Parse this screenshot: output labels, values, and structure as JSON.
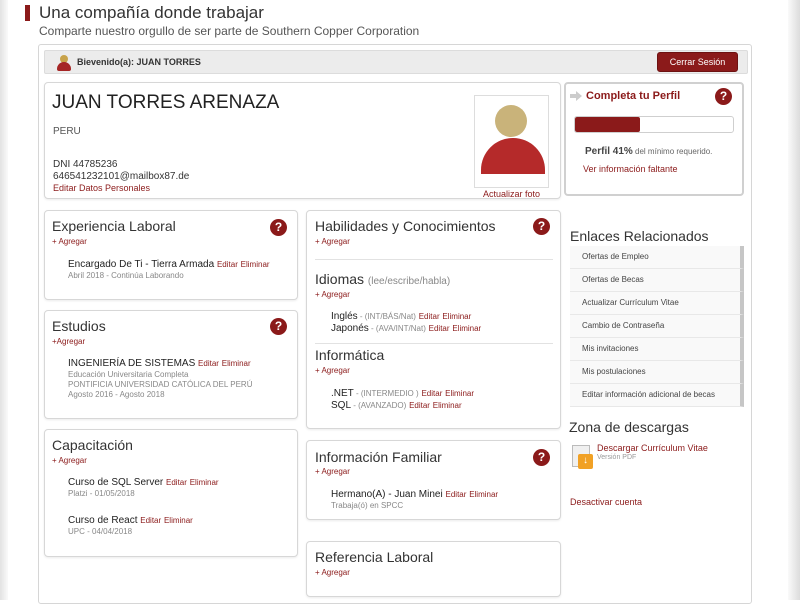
{
  "header": {
    "title": "Una compañía donde trabajar",
    "subtitle": "Comparte nuestro orgullo de ser parte de Southern Copper Corporation"
  },
  "welcome": {
    "text": "Bievenido(a): JUAN TORRES",
    "logout_label": "Cerrar Sesión"
  },
  "profile": {
    "name": "JUAN TORRES ARENAZA",
    "country": "PERU",
    "dni": "DNI 44785236",
    "contact": "646541232101@mailbox87.de",
    "edit_label": "Editar Datos Personales",
    "photo_link": "Actualizar foto"
  },
  "experiencia": {
    "title": "Experiencia Laboral",
    "add": "+ Agregar",
    "items": [
      {
        "main": "Encargado De Ti - Tierra Armada",
        "edit": "Editar",
        "delete": "Eliminar",
        "sub": "Abril 2018 - Continúa Laborando"
      }
    ]
  },
  "estudios": {
    "title": "Estudios",
    "add": "+Agregar",
    "items": [
      {
        "main": "INGENIERÍA DE SISTEMAS",
        "edit": "Editar",
        "delete": "Eliminar",
        "sub1": "Educación Universitaria Completa",
        "sub2": "PONTIFICIA UNIVERSIDAD CATÓLICA DEL PERÚ",
        "sub3": "Agosto 2016 - Agosto 2018"
      }
    ]
  },
  "capacitacion": {
    "title": "Capacitación",
    "add": "+ Agregar",
    "items": [
      {
        "main": "Curso de SQL Server",
        "edit": "Editar",
        "delete": "Eliminar",
        "sub": "Platzi - 01/05/2018"
      },
      {
        "main": "Curso de React",
        "edit": "Editar",
        "delete": "Eliminar",
        "sub": "UPC - 04/04/2018"
      }
    ]
  },
  "habilidades": {
    "title": "Habilidades y Conocimientos",
    "add": "+ Agregar",
    "idiomas": {
      "title": "Idiomas",
      "note": "(lee/escribe/habla)",
      "add": "+ Agregar",
      "items": [
        {
          "name": "Inglés",
          "level": " - (INT/BÁS/Nat)",
          "edit": "Editar",
          "delete": "Eliminar"
        },
        {
          "name": "Japonés",
          "level": " - (AVA/INT/Nat)",
          "edit": "Editar",
          "delete": "Eliminar"
        }
      ]
    },
    "informatica": {
      "title": "Informática",
      "add": "+ Agregar",
      "items": [
        {
          "name": ".NET",
          "level": " - (INTERMEDIO )",
          "edit": "Editar",
          "delete": "Eliminar"
        },
        {
          "name": "SQL",
          "level": " - (AVANZADO)",
          "edit": "Editar",
          "delete": "Eliminar"
        }
      ]
    }
  },
  "familiar": {
    "title": "Información Familiar",
    "add": "+ Agregar",
    "items": [
      {
        "main": "Hermano(A) - Juan Minei",
        "edit": "Editar",
        "delete": "Eliminar",
        "sub": "Trabaja(ó) en SPCC"
      }
    ]
  },
  "referencia": {
    "title": "Referencia Laboral",
    "add": "+ Agregar"
  },
  "sidebar": {
    "complete_title": "Completa tu Perfil",
    "progress_percent": 41,
    "perfil_label": "Perfil 41%",
    "perfil_suffix": " del mínimo requerido.",
    "missing_link": "Ver información faltante",
    "related_title": "Enlaces Relacionados",
    "related_links": [
      "Ofertas de Empleo",
      "Ofertas de Becas",
      "Actualizar Currículum Vitae",
      "Cambio de Contraseña",
      "Mis invitaciones",
      "Mis postulaciones",
      "Editar información adicional de becas"
    ],
    "downloads_title": "Zona de descargas",
    "download_link": "Descargar Currículum Vitae",
    "download_sub": "Versión PDF",
    "deactivate": "Desactivar cuenta"
  },
  "colors": {
    "accent": "#8b1a1a",
    "help": "#8b1a1a",
    "download_icon": "#f1a125"
  },
  "icons": {
    "help": "question-circle-icon",
    "avatar": "user-avatar-icon",
    "arrow": "arrow-right-icon",
    "download": "pdf-download-icon"
  }
}
